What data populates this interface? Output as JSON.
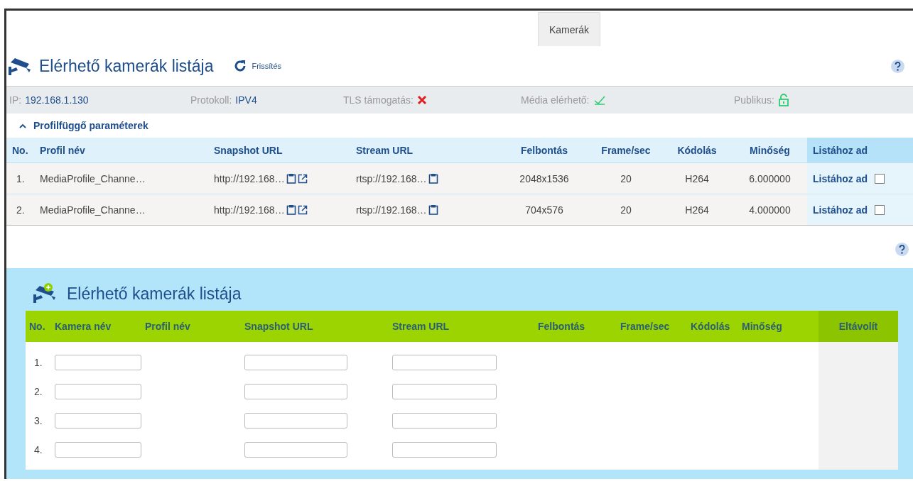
{
  "tabs": [
    {
      "label": "Kamerák",
      "selected": true
    }
  ],
  "camera_list": {
    "title": "Elérhető kamerák listája",
    "refresh_label": "Frissítés",
    "info": {
      "ip_label": "IP:",
      "ip": "192.168.1.130",
      "protocol_label": "Protokoll:",
      "protocol": "IPV4",
      "tls_label": "TLS támogatás:",
      "tls_supported": false,
      "media_label": "Média elérhető:",
      "media_available": true,
      "public_label": "Publikus:",
      "public": true
    },
    "profiles_toggle": {
      "label": "Profilfüggő paraméterek",
      "expanded": true
    },
    "columns": [
      "No.",
      "Profil név",
      "Snapshot URL",
      "Stream URL",
      "Felbontás",
      "Frame/sec",
      "Kódolás",
      "Minőség",
      "Listához ad"
    ],
    "rows": [
      {
        "no": "1.",
        "profile": "MediaProfile_Channe…",
        "snapshot": "http://192.168…",
        "stream": "rtsp://192.168…",
        "resolution": "2048x1536",
        "fps": "20",
        "encoding": "H264",
        "quality": "6.000000",
        "add_label": "Listához ad",
        "checked": false
      },
      {
        "no": "2.",
        "profile": "MediaProfile_Channe…",
        "snapshot": "http://192.168…",
        "stream": "rtsp://192.168…",
        "resolution": "704x576",
        "fps": "20",
        "encoding": "H264",
        "quality": "4.000000",
        "add_label": "Listához ad",
        "checked": false
      }
    ]
  },
  "selected_list": {
    "title": "Elérhető kamerák listája",
    "columns": [
      "No.",
      "Kamera név",
      "Profil név",
      "Snapshot URL",
      "Stream URL",
      "Felbontás",
      "Frame/sec",
      "Kódolás",
      "Minőség",
      "Eltávolít"
    ],
    "rows": [
      {
        "no": "1."
      },
      {
        "no": "2."
      },
      {
        "no": "3."
      },
      {
        "no": "4."
      }
    ]
  }
}
